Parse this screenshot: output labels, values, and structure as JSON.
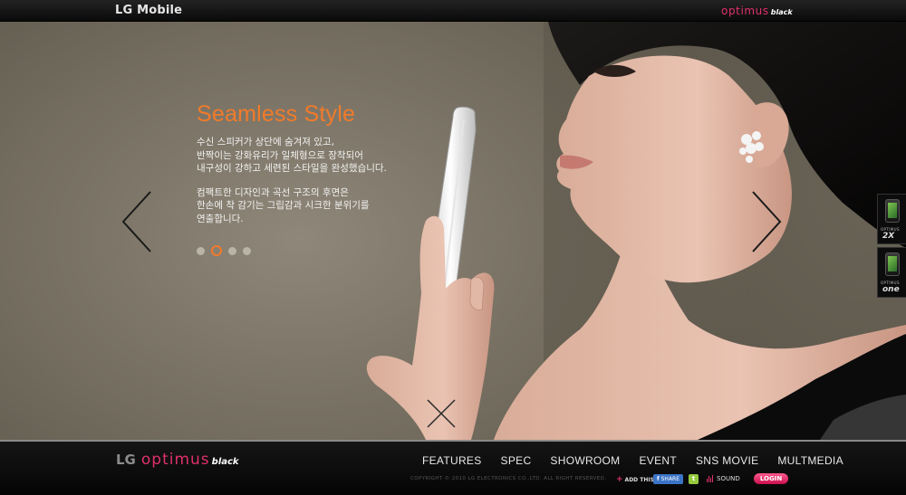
{
  "header": {
    "logo": "LG Mobile",
    "brand_name": "optimus",
    "brand_suffix": "black"
  },
  "slide": {
    "title": "Seamless Style",
    "paragraph1": [
      "수신 스피커가 상단에 숨겨져 있고,",
      "반짝이는 강화유리가 일체형으로 장착되어",
      "내구성이 강하고 세련된 스타일을 완성했습니다."
    ],
    "paragraph2": [
      "컴팩트한 디자인과 곡선 구조의 후면은",
      "한손에 착 감기는 그립감과 시크한 분위기를",
      "연출합니다."
    ],
    "dots_total": 4,
    "active_dot": 2
  },
  "side_phones": [
    {
      "top_label": "OPTIMUS",
      "model": "2X"
    },
    {
      "top_label": "OPTIMUS",
      "model": "one"
    }
  ],
  "footer": {
    "logo_lg": "LG",
    "brand_name": "optimus",
    "brand_suffix": "black",
    "nav": [
      "FEATURES",
      "SPEC",
      "SHOWROOM",
      "EVENT",
      "SNS MOVIE",
      "MULTMEDIA"
    ],
    "copyright": "COPYRIGHT © 2010 LG ELECTRONICS CO.,LTD.  ALL RIGHT RESERVED.",
    "add_this": "ADD THIS",
    "share": "SHARE",
    "sound": "SOUND",
    "login": "LOGIN"
  },
  "colors": {
    "accent": "#f27a2a",
    "brand_pink": "#e0306a"
  },
  "icons": {
    "prev": "chevron-left-icon",
    "next": "chevron-right-icon",
    "close": "close-icon"
  }
}
